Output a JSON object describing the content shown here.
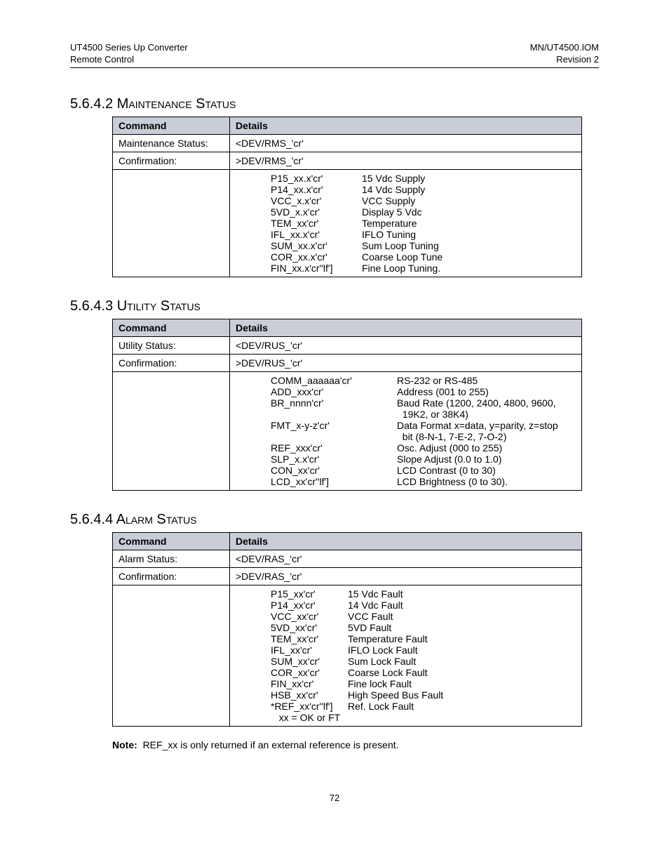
{
  "header": {
    "left1": "UT4500 Series Up Converter",
    "left2": "Remote Control",
    "right1": "MN/UT4500.IOM",
    "right2": "Revision 2"
  },
  "section_maintenance": {
    "number": "5.6.4.2",
    "title": "Maintenance Status",
    "th_command": "Command",
    "th_details": "Details",
    "row1_label": "Maintenance Status:",
    "row1_value": "<DEV/RMS_'cr'",
    "row2_label": "Confirmation:",
    "row2_value": ">DEV/RMS_'cr'",
    "codes": "P15_xx.x'cr'\nP14_xx.x'cr'\nVCC_x.x'cr'\n5VD_x.x'cr'\nTEM_xx'cr'\nIFL_xx.x'cr'\nSUM_xx.x'cr'\nCOR_xx.x'cr'\nFIN_xx.x'cr''lf']",
    "descs": "15 Vdc Supply\n14 Vdc Supply\nVCC Supply\nDisplay 5 Vdc\nTemperature\nIFLO Tuning\nSum Loop Tuning\nCoarse Loop Tune\nFine Loop Tuning."
  },
  "section_utility": {
    "number": "5.6.4.3",
    "title": "Utility Status",
    "th_command": "Command",
    "th_details": "Details",
    "row1_label": "Utility Status:",
    "row1_value": "<DEV/RUS_'cr'",
    "row2_label": "Confirmation:",
    "row2_value": ">DEV/RUS_'cr'",
    "codes": "COMM_aaaaaa'cr'\nADD_xxx'cr'\nBR_nnnn'cr'\n\nFMT_x-y-z'cr'\n\nREF_xxx'cr'\nSLP_x.x'cr'\nCON_xx'cr'\nLCD_xx'cr''lf']",
    "descs": "RS-232 or RS-485\nAddress (001 to 255)\nBaud Rate (1200, 2400, 4800, 9600,\n  19K2, or 38K4)\nData Format x=data, y=parity, z=stop\n  bit (8-N-1, 7-E-2, 7-O-2)\nOsc. Adjust (000 to 255)\nSlope Adjust (0.0 to 1.0)\nLCD Contrast (0 to 30)\nLCD Brightness (0 to 30)."
  },
  "section_alarm": {
    "number": "5.6.4.4",
    "title": "Alarm Status",
    "th_command": "Command",
    "th_details": "Details",
    "row1_label": "Alarm Status:",
    "row1_value": "<DEV/RAS_'cr'",
    "row2_label": "Confirmation:",
    "row2_value": ">DEV/RAS_'cr'",
    "codes": "P15_xx'cr'\nP14_xx'cr'\nVCC_xx'cr'\n5VD_xx'cr'\nTEM_xx'cr'\nIFL_xx'cr'\nSUM_xx'cr'\nCOR_xx'cr'\nFIN_xx'cr'\nHSB_xx'cr'\n*REF_xx'cr''lf']\n   xx = OK or FT",
    "descs": "15 Vdc Fault\n14 Vdc Fault\nVCC Fault\n5VD Fault\nTemperature Fault\nIFLO Lock Fault\nSum Lock Fault\nCoarse Lock Fault\nFine lock Fault\nHigh Speed Bus Fault\nRef. Lock Fault"
  },
  "note": {
    "label": "Note:",
    "text": "REF_xx is only returned if an external reference is present."
  },
  "page_number": "72"
}
